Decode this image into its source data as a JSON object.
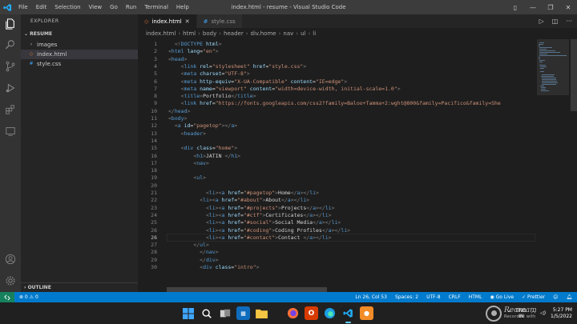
{
  "titlebar": {
    "menu": [
      "File",
      "Edit",
      "Selection",
      "View",
      "Go",
      "Run",
      "Terminal",
      "Help"
    ],
    "window_title": "index.html - resume - Visual Studio Code"
  },
  "sidebar": {
    "header": "EXPLORER",
    "section": "RESUME",
    "items": [
      {
        "label": "images",
        "icon": "chevron-right-icon"
      },
      {
        "label": "index.html",
        "icon": "html-file-icon"
      },
      {
        "label": "style.css",
        "icon": "css-file-icon"
      }
    ],
    "outline": "OUTLINE"
  },
  "tabs": [
    {
      "label": "index.html",
      "active": true
    },
    {
      "label": "style.css",
      "active": false
    }
  ],
  "breadcrumb": [
    "index.html",
    "html",
    "body",
    "header",
    "div.home",
    "nav",
    "ul",
    "li"
  ],
  "editor": {
    "current_line": 26,
    "lines": [
      {
        "n": "1",
        "i": "  ",
        "tokens": [
          [
            "br",
            "<!"
          ],
          [
            "tag",
            "DOCTYPE"
          ],
          [
            "attr",
            " html"
          ],
          [
            "br",
            ">"
          ]
        ]
      },
      {
        "n": "2",
        "i": "",
        "tokens": [
          [
            "br",
            "<"
          ],
          [
            "tag",
            "html"
          ],
          [
            "attr",
            " lang"
          ],
          [
            "txt",
            "="
          ],
          [
            "str",
            "\"en\""
          ],
          [
            "br",
            ">"
          ]
        ]
      },
      {
        "n": "3",
        "i": "",
        "tokens": [
          [
            "br",
            "<"
          ],
          [
            "tag",
            "head"
          ],
          [
            "br",
            ">"
          ]
        ]
      },
      {
        "n": "4",
        "i": "    ",
        "tokens": [
          [
            "br",
            "<"
          ],
          [
            "tag",
            "link"
          ],
          [
            "attr",
            " rel"
          ],
          [
            "txt",
            "="
          ],
          [
            "str",
            "\"stylesheet\""
          ],
          [
            "attr",
            " href"
          ],
          [
            "txt",
            "="
          ],
          [
            "str",
            "\"style.css\""
          ],
          [
            "br",
            ">"
          ]
        ]
      },
      {
        "n": "5",
        "i": "    ",
        "tokens": [
          [
            "br",
            "<"
          ],
          [
            "tag",
            "meta"
          ],
          [
            "attr",
            " charset"
          ],
          [
            "txt",
            "="
          ],
          [
            "str",
            "\"UTF-8\""
          ],
          [
            "br",
            ">"
          ]
        ]
      },
      {
        "n": "6",
        "i": "    ",
        "tokens": [
          [
            "br",
            "<"
          ],
          [
            "tag",
            "meta"
          ],
          [
            "attr",
            " http-equiv"
          ],
          [
            "txt",
            "="
          ],
          [
            "str",
            "\"X-UA-Compatible\""
          ],
          [
            "attr",
            " content"
          ],
          [
            "txt",
            "="
          ],
          [
            "str",
            "\"IE=edge\""
          ],
          [
            "br",
            ">"
          ]
        ]
      },
      {
        "n": "7",
        "i": "    ",
        "tokens": [
          [
            "br",
            "<"
          ],
          [
            "tag",
            "meta"
          ],
          [
            "attr",
            " name"
          ],
          [
            "txt",
            "="
          ],
          [
            "str",
            "\"viewport\""
          ],
          [
            "attr",
            " content"
          ],
          [
            "txt",
            "="
          ],
          [
            "str",
            "\"width=device-width, initial-scale=1.0\""
          ],
          [
            "br",
            ">"
          ]
        ]
      },
      {
        "n": "8",
        "i": "    ",
        "tokens": [
          [
            "br",
            "<"
          ],
          [
            "tag",
            "title"
          ],
          [
            "br",
            ">"
          ],
          [
            "txt",
            "Portfolio"
          ],
          [
            "br",
            "</"
          ],
          [
            "tag",
            "title"
          ],
          [
            "br",
            ">"
          ]
        ]
      },
      {
        "n": "9",
        "i": "    ",
        "tokens": [
          [
            "br",
            "<"
          ],
          [
            "tag",
            "link"
          ],
          [
            "attr",
            " href"
          ],
          [
            "txt",
            "="
          ],
          [
            "str",
            "\"https://fonts.googleapis.com/css2?family=Baloo+Tamma+2:wght@800&family=Pacifico&family=She"
          ]
        ]
      },
      {
        "n": "10",
        "i": "",
        "tokens": [
          [
            "br",
            "</"
          ],
          [
            "tag",
            "head"
          ],
          [
            "br",
            ">"
          ]
        ]
      },
      {
        "n": "11",
        "i": "",
        "tokens": [
          [
            "br",
            "<"
          ],
          [
            "tag",
            "body"
          ],
          [
            "br",
            ">"
          ]
        ]
      },
      {
        "n": "12",
        "i": "  ",
        "tokens": [
          [
            "br",
            "<"
          ],
          [
            "tag",
            "a"
          ],
          [
            "attr",
            " id"
          ],
          [
            "txt",
            "="
          ],
          [
            "str",
            "\"pagetop\""
          ],
          [
            "br",
            "></"
          ],
          [
            "tag",
            "a"
          ],
          [
            "br",
            ">"
          ]
        ]
      },
      {
        "n": "13",
        "i": "    ",
        "tokens": [
          [
            "br",
            "<"
          ],
          [
            "tag",
            "header"
          ],
          [
            "br",
            ">"
          ]
        ]
      },
      {
        "n": "14",
        "i": "",
        "tokens": []
      },
      {
        "n": "15",
        "i": "    ",
        "tokens": [
          [
            "br",
            "<"
          ],
          [
            "tag",
            "div"
          ],
          [
            "attr",
            " class"
          ],
          [
            "txt",
            "="
          ],
          [
            "str",
            "\"home\""
          ],
          [
            "br",
            ">"
          ]
        ]
      },
      {
        "n": "16",
        "i": "        ",
        "tokens": [
          [
            "br",
            "<"
          ],
          [
            "tag",
            "h1"
          ],
          [
            "br",
            ">"
          ],
          [
            "txt",
            "JATIN "
          ],
          [
            "br",
            "</"
          ],
          [
            "tag",
            "h1"
          ],
          [
            "br",
            ">"
          ]
        ]
      },
      {
        "n": "17",
        "i": "        ",
        "tokens": [
          [
            "br",
            "<"
          ],
          [
            "tag",
            "nav"
          ],
          [
            "br",
            ">"
          ]
        ]
      },
      {
        "n": "18",
        "i": "",
        "tokens": []
      },
      {
        "n": "19",
        "i": "        ",
        "tokens": [
          [
            "br",
            "<"
          ],
          [
            "tag",
            "ul"
          ],
          [
            "br",
            ">"
          ]
        ]
      },
      {
        "n": "20",
        "i": "",
        "tokens": []
      },
      {
        "n": "21",
        "i": "            ",
        "tokens": [
          [
            "br",
            "<"
          ],
          [
            "tag",
            "li"
          ],
          [
            "br",
            "><"
          ],
          [
            "tag",
            "a"
          ],
          [
            "attr",
            " href"
          ],
          [
            "txt",
            "="
          ],
          [
            "str",
            "\"#pagetop\""
          ],
          [
            "br",
            ">"
          ],
          [
            "txt",
            "Home"
          ],
          [
            "br",
            "</"
          ],
          [
            "tag",
            "a"
          ],
          [
            "br",
            "></"
          ],
          [
            "tag",
            "li"
          ],
          [
            "br",
            ">"
          ]
        ]
      },
      {
        "n": "22",
        "i": "          ",
        "tokens": [
          [
            "br",
            "<"
          ],
          [
            "tag",
            "li"
          ],
          [
            "br",
            "><"
          ],
          [
            "tag",
            "a"
          ],
          [
            "attr",
            " href"
          ],
          [
            "txt",
            "="
          ],
          [
            "str",
            "\"#about\""
          ],
          [
            "br",
            ">"
          ],
          [
            "txt",
            "About"
          ],
          [
            "br",
            "</"
          ],
          [
            "tag",
            "a"
          ],
          [
            "br",
            "></"
          ],
          [
            "tag",
            "li"
          ],
          [
            "br",
            ">"
          ]
        ]
      },
      {
        "n": "23",
        "i": "            ",
        "tokens": [
          [
            "br",
            "<"
          ],
          [
            "tag",
            "li"
          ],
          [
            "br",
            "><"
          ],
          [
            "tag",
            "a"
          ],
          [
            "attr",
            " href"
          ],
          [
            "txt",
            "="
          ],
          [
            "str",
            "\"#projects\""
          ],
          [
            "br",
            ">"
          ],
          [
            "txt",
            "Projects"
          ],
          [
            "br",
            "</"
          ],
          [
            "tag",
            "a"
          ],
          [
            "br",
            "></"
          ],
          [
            "tag",
            "li"
          ],
          [
            "br",
            ">"
          ]
        ]
      },
      {
        "n": "24",
        "i": "            ",
        "tokens": [
          [
            "br",
            "<"
          ],
          [
            "tag",
            "li"
          ],
          [
            "br",
            "><"
          ],
          [
            "tag",
            "a"
          ],
          [
            "attr",
            " href"
          ],
          [
            "txt",
            "="
          ],
          [
            "str",
            "\"#ctf\""
          ],
          [
            "br",
            ">"
          ],
          [
            "txt",
            "Certificates"
          ],
          [
            "br",
            "</"
          ],
          [
            "tag",
            "a"
          ],
          [
            "br",
            "></"
          ],
          [
            "tag",
            "li"
          ],
          [
            "br",
            ">"
          ]
        ]
      },
      {
        "n": "25",
        "i": "            ",
        "tokens": [
          [
            "br",
            "<"
          ],
          [
            "tag",
            "li"
          ],
          [
            "br",
            "><"
          ],
          [
            "tag",
            "a"
          ],
          [
            "attr",
            " href"
          ],
          [
            "txt",
            "="
          ],
          [
            "str",
            "\"#social\""
          ],
          [
            "br",
            ">"
          ],
          [
            "txt",
            "Social Media"
          ],
          [
            "br",
            "</"
          ],
          [
            "tag",
            "a"
          ],
          [
            "br",
            "></"
          ],
          [
            "tag",
            "li"
          ],
          [
            "br",
            ">"
          ]
        ]
      },
      {
        "n": "26",
        "i": "            ",
        "tokens": [
          [
            "br",
            "<"
          ],
          [
            "tag",
            "li"
          ],
          [
            "br",
            "><"
          ],
          [
            "tag",
            "a"
          ],
          [
            "attr",
            " href"
          ],
          [
            "txt",
            "="
          ],
          [
            "str",
            "\"#coding\""
          ],
          [
            "br",
            ">"
          ],
          [
            "txt",
            "Coding Profiles"
          ],
          [
            "br",
            "</"
          ],
          [
            "tag",
            "a"
          ],
          [
            "br",
            "></"
          ],
          [
            "tag",
            "li"
          ],
          [
            "br",
            ">"
          ]
        ]
      },
      {
        "n": "26",
        "i": "            ",
        "tokens": [
          [
            "br",
            "<"
          ],
          [
            "tag",
            "li"
          ],
          [
            "br",
            "><"
          ],
          [
            "tag",
            "a"
          ],
          [
            "attr",
            " href"
          ],
          [
            "txt",
            "="
          ],
          [
            "str",
            "\"#contact\""
          ],
          [
            "br",
            ">"
          ],
          [
            "txt",
            "Contact "
          ],
          [
            "br",
            "</"
          ],
          [
            "tag",
            "a"
          ],
          [
            "br",
            "></"
          ],
          [
            "tag",
            "li"
          ],
          [
            "br",
            ">"
          ]
        ]
      },
      {
        "n": "27",
        "i": "        ",
        "tokens": [
          [
            "br",
            "</"
          ],
          [
            "tag",
            "ul"
          ],
          [
            "br",
            ">"
          ]
        ]
      },
      {
        "n": "28",
        "i": "          ",
        "tokens": [
          [
            "br",
            "</"
          ],
          [
            "tag",
            "nav"
          ],
          [
            "br",
            ">"
          ]
        ]
      },
      {
        "n": "29",
        "i": "          ",
        "tokens": [
          [
            "br",
            "</"
          ],
          [
            "tag",
            "div"
          ],
          [
            "br",
            ">"
          ]
        ]
      },
      {
        "n": "30",
        "i": "          ",
        "tokens": [
          [
            "br",
            "<"
          ],
          [
            "tag",
            "div"
          ],
          [
            "attr",
            " class"
          ],
          [
            "txt",
            "="
          ],
          [
            "str",
            "\"intro\""
          ],
          [
            "br",
            ">"
          ]
        ]
      }
    ]
  },
  "statusbar": {
    "problems": "⊗ 0 ⚠ 0",
    "position": "Ln 26, Col 53",
    "spaces": "Spaces: 2",
    "encoding": "UTF-8",
    "eol": "CRLF",
    "language": "HTML",
    "golive": "Go Live",
    "prettier": "Prettier"
  },
  "taskbar": {
    "lang_line1": "ENG",
    "lang_line2": "IN",
    "time": "5:27 PM",
    "date": "1/5/2022"
  },
  "watermark": {
    "line1": "Recream",
    "line2": "Recorded with"
  },
  "colors": {
    "status_bar": "#007acc",
    "remote_button": "#16825d",
    "activity_bar": "#333333",
    "editor_bg": "#1e1e1e"
  }
}
